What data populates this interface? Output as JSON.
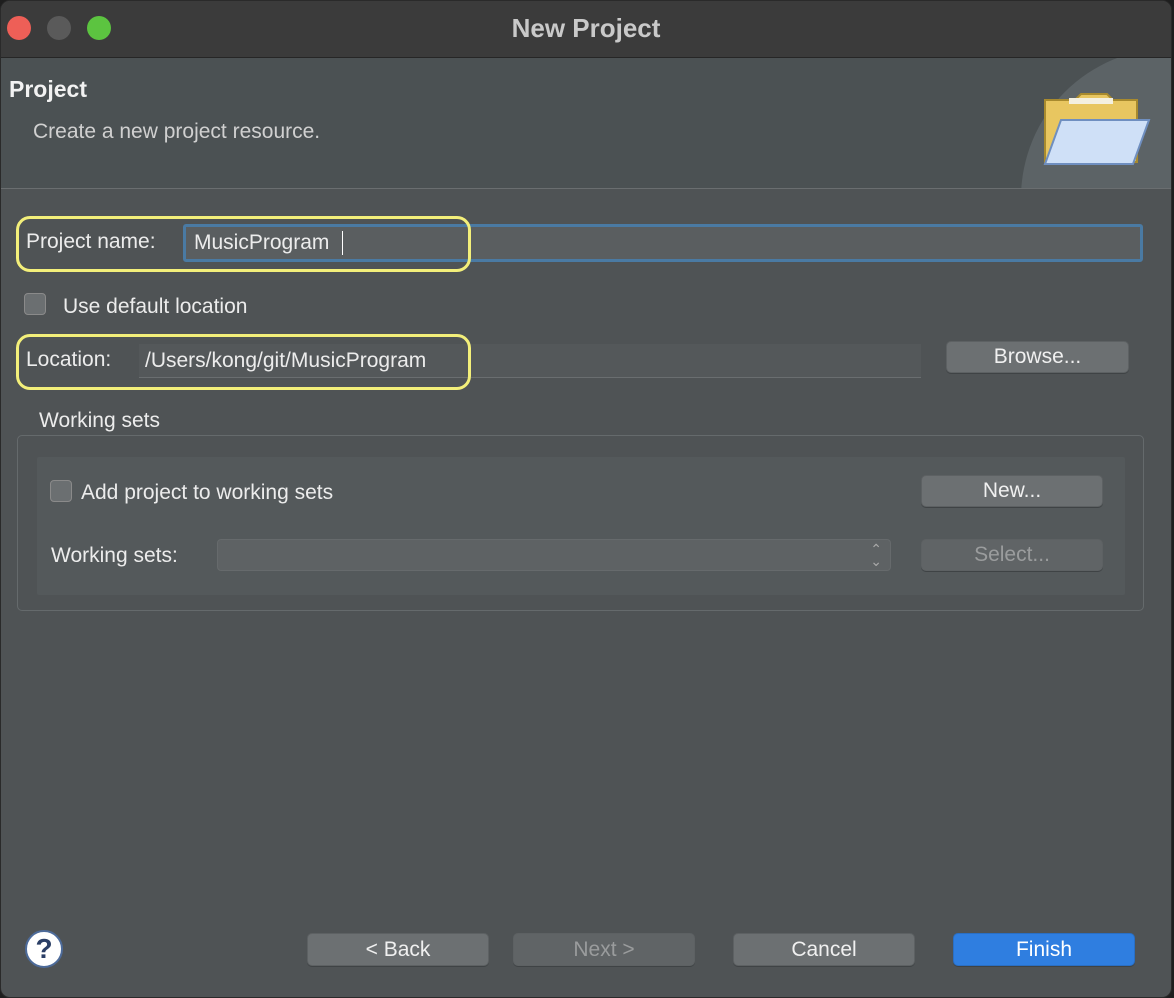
{
  "window": {
    "title": "New Project"
  },
  "header": {
    "title": "Project",
    "description": "Create a new project resource."
  },
  "form": {
    "project_name_label": "Project name:",
    "project_name_value": "MusicProgram",
    "use_default_location_label": "Use default location",
    "use_default_location_checked": false,
    "location_label": "Location:",
    "location_value": "/Users/kong/git/MusicProgram",
    "browse_label": "Browse..."
  },
  "working_sets": {
    "group_label": "Working sets",
    "add_label": "Add project to working sets",
    "add_checked": false,
    "new_label": "New...",
    "sets_label": "Working sets:",
    "sets_value": "",
    "select_label": "Select..."
  },
  "footer": {
    "help_icon": "?",
    "back_label": "< Back",
    "next_label": "Next >",
    "cancel_label": "Cancel",
    "finish_label": "Finish"
  },
  "colors": {
    "accent": "#2f7ee0",
    "highlight": "#f3ef7a",
    "window_bg": "#4f5355"
  }
}
